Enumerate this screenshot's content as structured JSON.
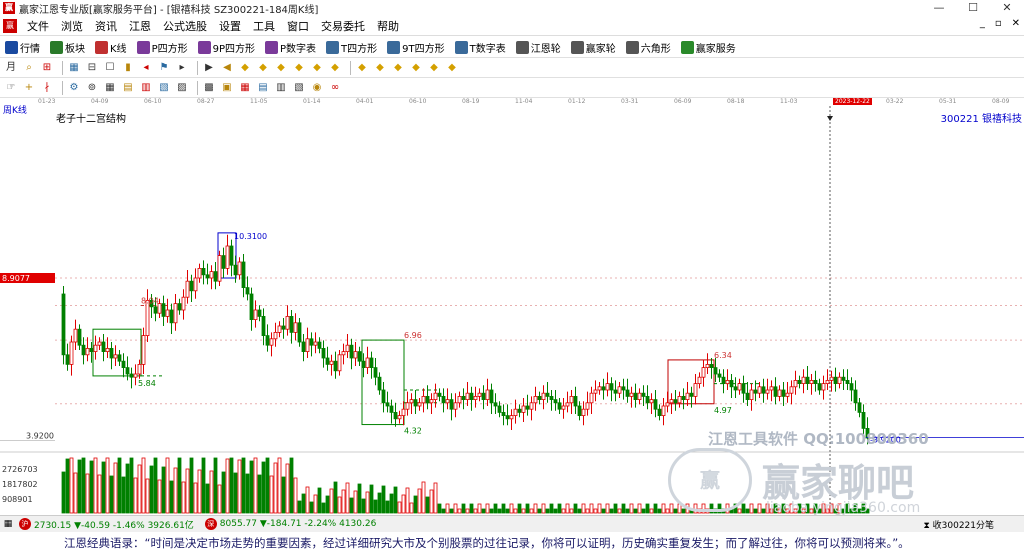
{
  "window": {
    "title": "赢家江恩专业版[赢家服务平台] - [银禧科技  SZ300221-184周K线]"
  },
  "menu": [
    "文件",
    "浏览",
    "资讯",
    "江恩",
    "公式选股",
    "设置",
    "工具",
    "窗口",
    "交易委托",
    "帮助"
  ],
  "toolbar": [
    {
      "label": "行情",
      "icon": "grid-icon",
      "color": "#1a4aa0"
    },
    {
      "label": "板块",
      "icon": "sector-icon",
      "color": "#2a7a2a"
    },
    {
      "label": "K线",
      "icon": "kline-icon",
      "color": "#c03030"
    },
    {
      "label": "P四方形",
      "icon": "square-p-icon",
      "color": "#7a3a9a"
    },
    {
      "label": "9P四方形",
      "icon": "square-9p-icon",
      "color": "#7a3a9a"
    },
    {
      "label": "P数字表",
      "icon": "number-table-icon",
      "color": "#7a3a9a"
    },
    {
      "label": "T四方形",
      "icon": "square-t-icon",
      "color": "#3a6a9a"
    },
    {
      "label": "9T四方形",
      "icon": "square-9t-icon",
      "color": "#3a6a9a"
    },
    {
      "label": "T数字表",
      "icon": "number-table-t-icon",
      "color": "#3a6a9a"
    },
    {
      "label": "江恩轮",
      "icon": "wheel-icon",
      "color": "#555555"
    },
    {
      "label": "赢家轮",
      "icon": "winner-wheel-icon",
      "color": "#555555"
    },
    {
      "label": "六角形",
      "icon": "hexagon-icon",
      "color": "#555555"
    },
    {
      "label": "赢家服务",
      "icon": "dollar-icon",
      "color": "#2a8a2a"
    }
  ],
  "tb2_icons": [
    "月",
    "⌕",
    "⊞",
    "▦",
    "⊟",
    "☐",
    "▮",
    "◂",
    "⚑",
    "▸",
    "▶",
    "◀",
    "◆",
    "◆",
    "◆",
    "◆",
    "◆",
    "◆",
    "◆",
    "◆",
    "◆",
    "◆",
    "◆",
    "◆"
  ],
  "tb3_icons": [
    "☞",
    "+",
    "∤",
    "⚙",
    "⊚",
    "▦",
    "▤",
    "▥",
    "▧",
    "▨",
    "▩",
    "▣",
    "▦",
    "▤",
    "▥",
    "▧",
    "◉",
    "∞"
  ],
  "time_ticks": [
    "01-23",
    "04-09",
    "06-10",
    "08-27",
    "11-05",
    "01-14",
    "04-01",
    "06-10",
    "08-19",
    "11-04",
    "01-12",
    "03-31",
    "06-09",
    "08-18",
    "11-03",
    "2023-12-22",
    "03-22",
    "05-31",
    "08-09"
  ],
  "chart": {
    "period_label": "周K线",
    "indicator": "老子十二宫结构",
    "stock": "300221  银禧科技",
    "left_price_marker": "8.9077",
    "last_price_label": "3.9200",
    "vol_labels": [
      "2726703",
      "1817802",
      "908901"
    ],
    "cursor_date": "2023-12-22",
    "levels": [
      {
        "label": "10.3100"
      },
      {
        "label": "8.04"
      },
      {
        "label": "5.84"
      },
      {
        "label": "6.96"
      },
      {
        "label": "4.32"
      },
      {
        "label": "6.34"
      },
      {
        "label": "4.97"
      },
      {
        "label": "-3.9200"
      }
    ]
  },
  "chart_data": {
    "type": "candlestick",
    "title": "",
    "y_ticks": [
      "3.9200"
    ],
    "annotations": [
      "10.3100",
      "8.04",
      "5.84",
      "6.96",
      "4.32",
      "6.34",
      "4.97",
      "-3.9200"
    ]
  },
  "watermark": {
    "line1": "江恩工具软件  QQ:100800360",
    "line2": "赢家聊吧",
    "line3": "liaoba.yingjia360.com"
  },
  "status": {
    "sh": "2730.15 ▼-40.59 -1.46% 3926.61亿",
    "sz": "8055.77 ▼-184.71 -2.24% 4130.26",
    "right": "收300221分笔",
    "quote": "江恩经典语录：“时间是决定市场走势的重要因素，经过详细研究大市及个别股票的过往记录，你将可以证明，历史确实重复发生；而了解过往，你将可以预测将来。”。"
  },
  "colors": {
    "up": "#e00000",
    "down": "#008000",
    "accent": "#0000cc"
  }
}
